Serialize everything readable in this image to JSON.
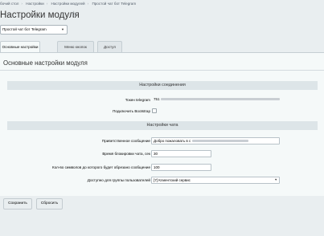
{
  "breadcrumbs": [
    "бочий стол",
    "Настройки",
    "Настройки модулей",
    "Простой чат бот Telegram"
  ],
  "page": {
    "title": "Настройки модуля"
  },
  "module_select": {
    "value": "Простой чат бот Telegram"
  },
  "tabs": [
    {
      "label": "Основные настройки",
      "active": true
    },
    {
      "label": "Меню кнопок",
      "active": false
    },
    {
      "label": "Доступ",
      "active": false
    }
  ],
  "panel": {
    "heading": "Основные настройки модуля"
  },
  "sections": {
    "connection": "Настройки соединения",
    "chat": "Настройки чата"
  },
  "fields": {
    "token": {
      "label": "Токен telegram",
      "value_prefix": "751",
      "value_suffix": "PM"
    },
    "bootstrap": {
      "label": "Подключить Bootstrap",
      "checked": false
    },
    "greeting": {
      "label": "Приветственное сообщение",
      "value": "Добро пожаловать в с"
    },
    "block_time": {
      "label": "Время блокировки чата, сек",
      "value": "30"
    },
    "truncate_length": {
      "label": "Кол-во символов до которого будет обрезано сообщение",
      "value": "100"
    },
    "user_group": {
      "label": "Доступно для группы пользователей",
      "value": "[7] Клиентский сервис"
    }
  },
  "buttons": {
    "save": "Сохранить",
    "reset": "Сбросить"
  },
  "colors": {
    "background": "#e9eef0",
    "panel": "#f5f9f9",
    "section_header": "#dde5e8"
  }
}
